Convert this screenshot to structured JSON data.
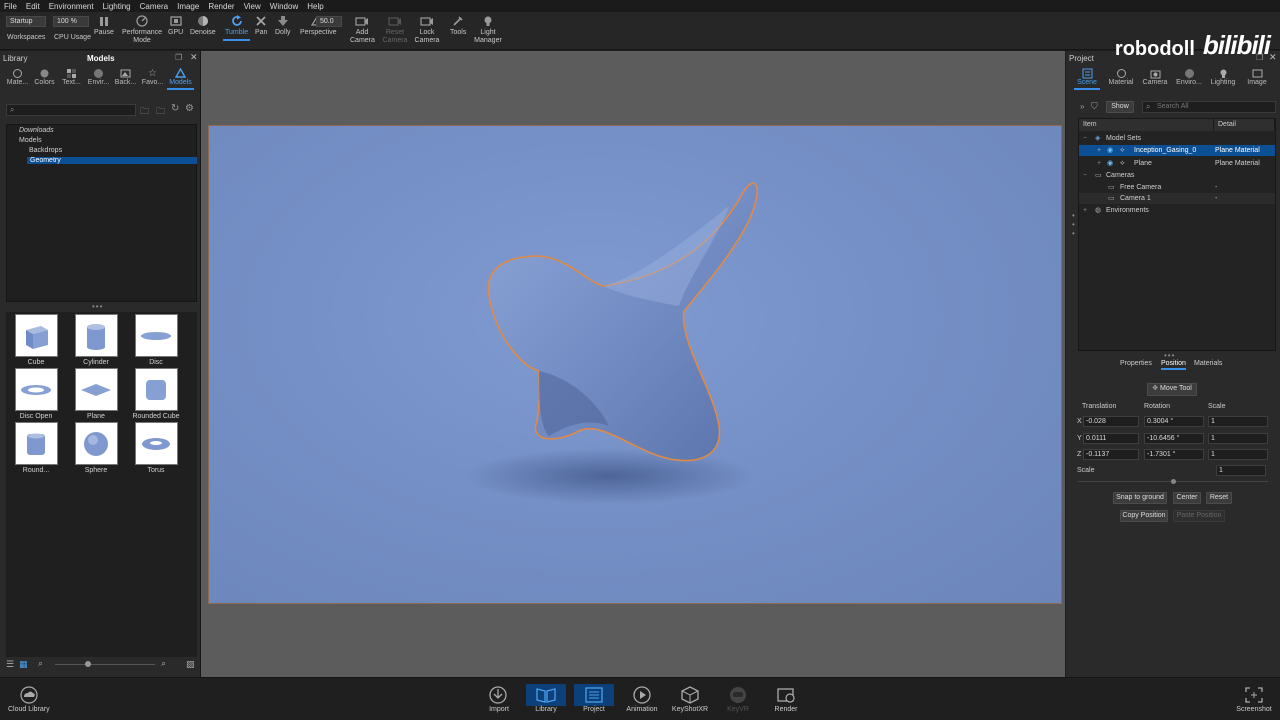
{
  "menu": [
    "File",
    "Edit",
    "Environment",
    "Lighting",
    "Camera",
    "Image",
    "Render",
    "View",
    "Window",
    "Help"
  ],
  "ribbon": {
    "workspace_value": "Startup",
    "cpu_value": "100 %",
    "fov_value": "50.0",
    "items": {
      "workspaces": "Workspaces",
      "cpu_usage": "CPU Usage",
      "pause": "Pause",
      "performance_mode": "Performance Mode",
      "gpu": "GPU",
      "denoise": "Denoise",
      "tumble": "Tumble",
      "pan": "Pan",
      "dolly": "Dolly",
      "perspective": "Perspective",
      "add_camera": "Add Camera",
      "reset_camera": "Reset Camera",
      "lock_camera": "Lock Camera",
      "tools": "Tools",
      "light_manager": "Light Manager"
    }
  },
  "library": {
    "title": "Library",
    "active_tab_title": "Models",
    "tabs": [
      "Mate...",
      "Colors",
      "Text...",
      "Envir...",
      "Back...",
      "Favo...",
      "Models"
    ],
    "tree": [
      "Downloads",
      "Models",
      "Backdrops",
      "Geometry"
    ],
    "models": [
      "Cube",
      "Cylinder",
      "Disc",
      "Disc Open",
      "Plane",
      "Rounded Cube",
      "Round...",
      "Sphere",
      "Torus"
    ]
  },
  "project": {
    "title": "Project",
    "tabs": [
      "Scene",
      "Material",
      "Camera",
      "Enviro...",
      "Lighting",
      "Image"
    ],
    "show_label": "Show",
    "search_placeholder": "Search All",
    "columns": [
      "Item",
      "Detail"
    ],
    "tree": {
      "model_sets": "Model Sets",
      "inception": "Inception_Gasing_0",
      "inception_detail": "Plane Material",
      "plane": "Plane",
      "plane_detail": "Plane Material",
      "cameras": "Cameras",
      "free_camera": "Free Camera",
      "free_camera_detail": "-",
      "camera1": "Camera 1",
      "camera1_detail": "-",
      "environments": "Environments"
    },
    "subtabs": [
      "Properties",
      "Position",
      "Materials"
    ],
    "move_tool": "Move Tool",
    "labels": {
      "translation": "Translation",
      "rotation": "Rotation",
      "scale": "Scale",
      "scale2": "Scale"
    },
    "axes": [
      "X",
      "Y",
      "Z"
    ],
    "translation": [
      "-0.028",
      "0.0111",
      "-0.1137"
    ],
    "rotation": [
      "0.3004 °",
      "-10.6456 °",
      "-1.7301 °"
    ],
    "scale": [
      "1",
      "1",
      "1"
    ],
    "uniform_scale": "1",
    "buttons": {
      "snap": "Snap to ground",
      "center": "Center",
      "reset": "Reset",
      "copy": "Copy Position",
      "paste": "Paste Position"
    }
  },
  "bottom": {
    "cloud_library": "Cloud Library",
    "import": "Import",
    "library": "Library",
    "project": "Project",
    "animation": "Animation",
    "keyshotxr": "KeyShotXR",
    "keyvr": "KeyVR",
    "render": "Render",
    "screenshot": "Screenshot"
  },
  "watermark": {
    "brand": "robodoll",
    "site": "bilibili"
  }
}
